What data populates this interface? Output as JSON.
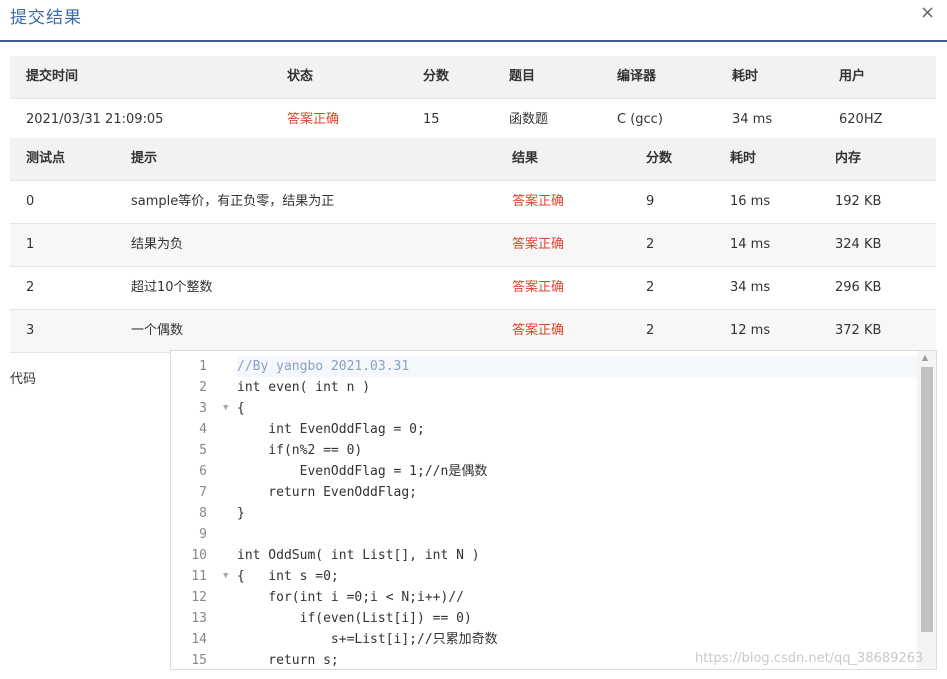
{
  "dialog": {
    "title": "提交结果",
    "close_glyph": "×"
  },
  "summary": {
    "headers": [
      "提交时间",
      "状态",
      "分数",
      "题目",
      "编译器",
      "耗时",
      "用户"
    ],
    "row": [
      "2021/03/31 21:09:05",
      "答案正确",
      "15",
      "函数题",
      "C (gcc)",
      "34 ms",
      "620HZ"
    ]
  },
  "tests": {
    "headers": [
      "测试点",
      "提示",
      "结果",
      "分数",
      "耗时",
      "内存"
    ],
    "rows": [
      [
        "0",
        "sample等价，有正负零，结果为正",
        "答案正确",
        "9",
        "16 ms",
        "192 KB"
      ],
      [
        "1",
        "结果为负",
        "答案正确",
        "2",
        "14 ms",
        "324 KB"
      ],
      [
        "2",
        "超过10个整数",
        "答案正确",
        "2",
        "34 ms",
        "296 KB"
      ],
      [
        "3",
        "一个偶数",
        "答案正确",
        "2",
        "12 ms",
        "372 KB"
      ]
    ]
  },
  "code": {
    "label": "代码",
    "lines": [
      {
        "n": "1",
        "fold": "",
        "text": "//By yangbo 2021.03.31"
      },
      {
        "n": "2",
        "fold": "",
        "text": "int even( int n )"
      },
      {
        "n": "3",
        "fold": "▼",
        "text": "{"
      },
      {
        "n": "4",
        "fold": "",
        "text": "    int EvenOddFlag = 0;"
      },
      {
        "n": "5",
        "fold": "",
        "text": "    if(n%2 == 0)"
      },
      {
        "n": "6",
        "fold": "",
        "text": "        EvenOddFlag = 1;//n是偶数"
      },
      {
        "n": "7",
        "fold": "",
        "text": "    return EvenOddFlag;"
      },
      {
        "n": "8",
        "fold": "",
        "text": "}"
      },
      {
        "n": "9",
        "fold": "",
        "text": ""
      },
      {
        "n": "10",
        "fold": "",
        "text": "int OddSum( int List[], int N )"
      },
      {
        "n": "11",
        "fold": "▼",
        "text": "{   int s =0;"
      },
      {
        "n": "12",
        "fold": "",
        "text": "    for(int i =0;i < N;i++)//"
      },
      {
        "n": "13",
        "fold": "",
        "text": "        if(even(List[i]) == 0)"
      },
      {
        "n": "14",
        "fold": "",
        "text": "            s+=List[i];//只累加奇数"
      },
      {
        "n": "15",
        "fold": "",
        "text": "    return s;"
      }
    ]
  },
  "scroll_up_glyph": "▲",
  "watermark": "https://blog.csdn.net/qq_38689263",
  "colors": {
    "accent": "#3c6bb0",
    "ok": "#e0452f",
    "header_bg": "#f2f2f2"
  }
}
